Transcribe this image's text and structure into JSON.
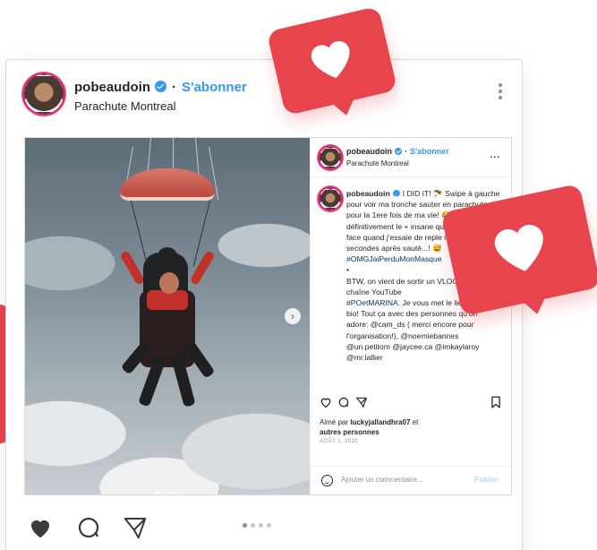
{
  "header": {
    "username": "pobeaudoin",
    "dot": "·",
    "follow_label": "S'abonner",
    "location": "Parachute Montreal"
  },
  "sidebar": {
    "username": "pobeaudoin",
    "dot": "·",
    "follow_label": "S'abonner",
    "location": "Parachute Montreal",
    "more": "...",
    "caption_user": "pobeaudoin",
    "caption_lines": [
      "I DID IT! 🪂 Swipe à gauche pour voir ma tronche sauter en parachute pour la 1ere fois de ma vie! 😂 C'est définitivement le + insane que j'ai vécut Sa face quand j'essaie de reple masque 2 secondes après sauté...! 😅",
      "#OMGJaiPerduMonMasque",
      "•",
      "BTW, on vient de sortir un VLOG notre chaîne YouTube",
      "#POetMARINA",
      ". Je vous met le lien dans ma bio! Tout ça avec des personnes qu'on adore: @cam_ds ( merci encore pour l'organisation!), @noemiebannes @un.petitom @jaycee.ca @imkaylaroy @mr.lallier"
    ],
    "likes_prefix": "Aimé par",
    "likes_user": "luckyjallandhra07",
    "likes_connector": "et",
    "likes_others": "autres personnes",
    "date": "AOÛT 1, 2020",
    "comment_placeholder": "Ajouter un commentaire...",
    "publish_label": "Publier"
  },
  "icons": {
    "verified": "verified-badge-icon",
    "heart": "heart-icon",
    "comment": "comment-icon",
    "share": "send-icon",
    "save": "bookmark-icon",
    "more": "kebab-icon"
  },
  "colors": {
    "accent": "#3897f0",
    "heart_bubble": "#e8444d",
    "text": "#262626"
  },
  "carousel": {
    "total": 4,
    "active": 1
  }
}
